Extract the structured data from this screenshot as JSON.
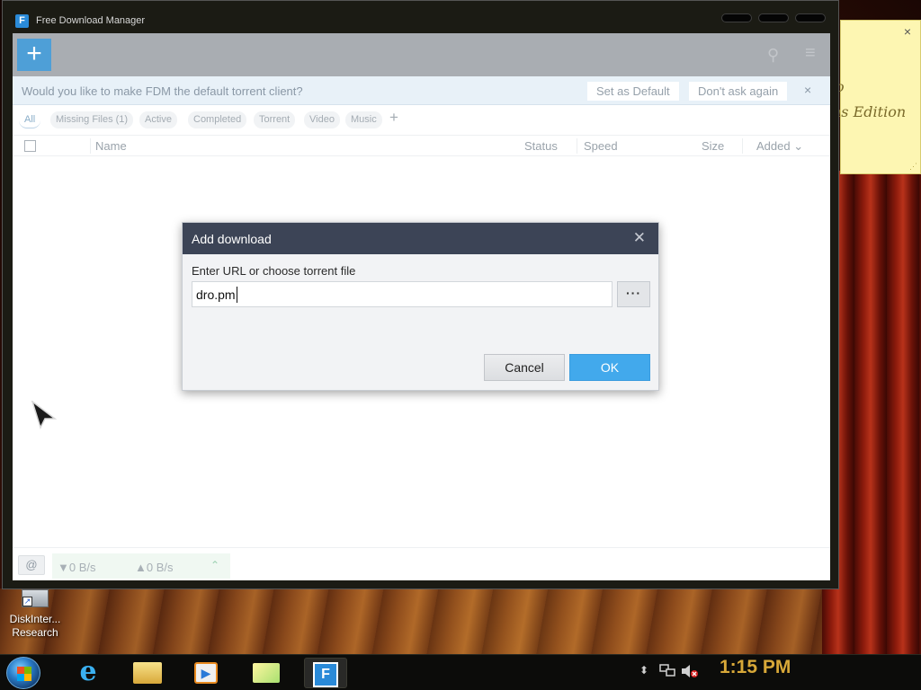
{
  "window": {
    "title": "Free Download Manager",
    "logo_glyph": "F",
    "icons": {
      "logo": "fdm-logo-icon",
      "add": "plus-icon",
      "search": "search-icon",
      "menu": "hamburger-menu-icon"
    }
  },
  "notification": {
    "text": "Would you like to make FDM the default torrent client?",
    "set_default_label": "Set as Default",
    "dont_ask_label": "Don't ask again",
    "close_glyph": "×"
  },
  "filters": {
    "tabs": [
      "All",
      "Missing Files (1)",
      "Active",
      "Completed",
      "Torrent",
      "Video",
      "Music"
    ],
    "add_glyph": "+"
  },
  "list_header": {
    "columns": [
      "Name",
      "Status",
      "Speed",
      "Size",
      "Added ⌄"
    ]
  },
  "status_bar": {
    "download_speed": "▼0 B/s",
    "upload_speed": "▲0 B/s",
    "toggle_glyph": "⌃",
    "snail_glyph": "@"
  },
  "dialog": {
    "title": "Add download",
    "close_glyph": "✕",
    "label": "Enter URL or choose torrent file",
    "url_value": "dro.pm",
    "browse_label": "···",
    "cancel_label": "Cancel",
    "ok_label": "OK"
  },
  "sticky_note": {
    "close_glyph": "×",
    "line1": "o",
    "line2": "ns Edition",
    "grip_glyph": "⋰"
  },
  "desktop": {
    "icon_label_line1": "DiskInter...",
    "icon_label_line2": "Research",
    "shortcut_glyph": "↗"
  },
  "taskbar": {
    "apps": [
      "internet-explorer",
      "windows-explorer",
      "media-player",
      "sticky-notes",
      "free-download-manager"
    ],
    "ie_glyph": "e",
    "media_glyph": "▶",
    "fdm_glyph": "F",
    "tray_expand_glyph": "⬍",
    "clock": "1:15 PM"
  },
  "colors": {
    "accent": "#42a9ec",
    "dialog_header": "#3c4456",
    "toolbar": "#a9adb2",
    "clock": "#d8a838"
  }
}
